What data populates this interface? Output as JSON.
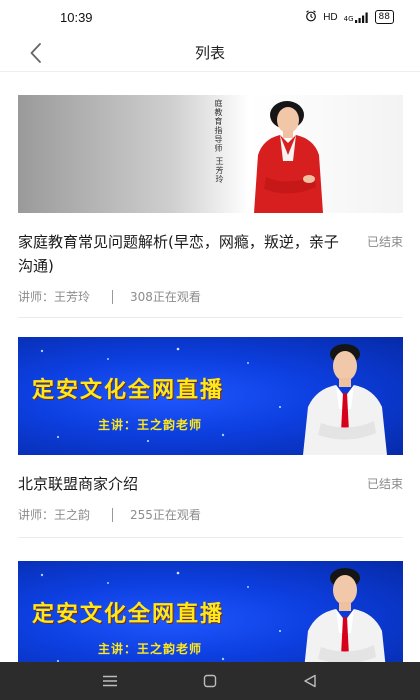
{
  "status_bar": {
    "time": "10:39",
    "network_label": "HD",
    "signal_label": "4G",
    "battery_label": "88"
  },
  "nav": {
    "title": "列表"
  },
  "items": [
    {
      "title": "家庭教育常见问题解析(早恋，网瘾，叛逆，亲子沟通)",
      "status": "已结束",
      "lecturer": "讲师：王芳玲",
      "viewers": "308正在观看",
      "thumb_caption": "庭教育指导师",
      "thumb_name": "王芳玲"
    },
    {
      "title": "北京联盟商家介绍",
      "status": "已结束",
      "lecturer": "讲师：王之韵",
      "viewers": "255正在观看",
      "banner_title": "定安文化全网直播",
      "banner_subtitle": "主讲：王之韵老师"
    },
    {
      "banner_title": "定安文化全网直播",
      "banner_subtitle": "主讲：王之韵老师"
    }
  ],
  "colors": {
    "banner_text": "#ffe81a",
    "banner_bg": "#0d3fe0",
    "jacket": "#d81f1f",
    "tie": "#d6001c"
  },
  "icons": {
    "back": "chevron-left-icon",
    "alarm": "alarm-icon",
    "signal": "signal-icon",
    "battery": "battery-icon",
    "menu": "menu-icon",
    "home": "home-icon",
    "nav_back": "triangle-back-icon"
  }
}
